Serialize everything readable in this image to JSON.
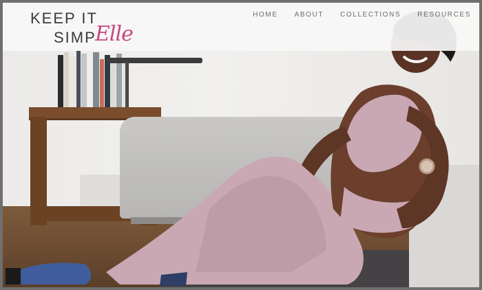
{
  "header": {
    "logo_line1": "KEEP IT",
    "logo_line2": "SIMP",
    "logo_script": "Elle",
    "brand_color": "#c8487d"
  },
  "nav": {
    "items": [
      {
        "label": "HOME"
      },
      {
        "label": "ABOUT"
      },
      {
        "label": "COLLECTIONS"
      },
      {
        "label": "RESOURCES"
      }
    ]
  },
  "hero": {
    "icon": "photo-woman-sitting-activewear"
  }
}
